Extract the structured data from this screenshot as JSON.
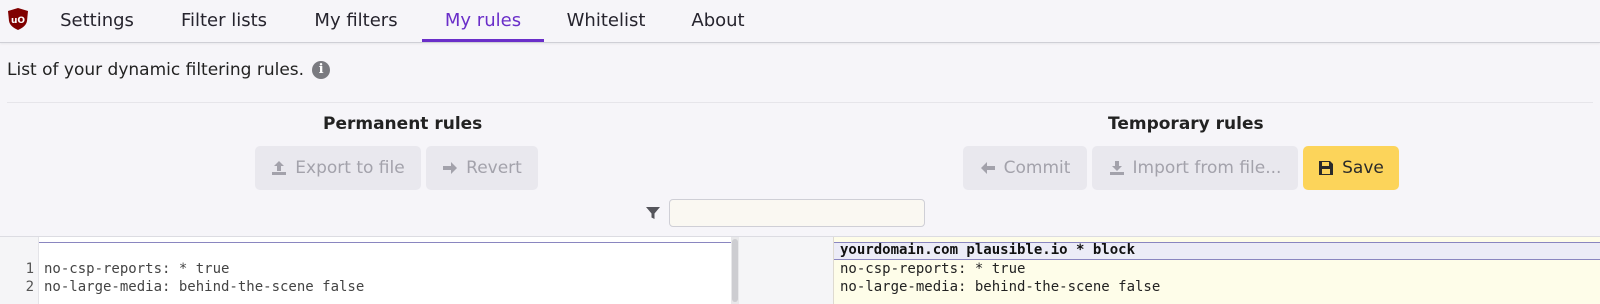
{
  "nav": {
    "tabs": [
      {
        "label": "Settings",
        "active": false
      },
      {
        "label": "Filter lists",
        "active": false
      },
      {
        "label": "My filters",
        "active": false
      },
      {
        "label": "My rules",
        "active": true
      },
      {
        "label": "Whitelist",
        "active": false
      },
      {
        "label": "About",
        "active": false
      }
    ],
    "logo_icon": "ublock-shield-icon"
  },
  "description": {
    "text": "List of your dynamic filtering rules.",
    "icon": "info-icon"
  },
  "permanent": {
    "title": "Permanent rules",
    "export_label": "Export to file",
    "revert_label": "Revert",
    "lines": [
      {
        "num": "1",
        "text": "no-csp-reports: * true"
      },
      {
        "num": "2",
        "text": "no-large-media: behind-the-scene false"
      }
    ]
  },
  "temporary": {
    "title": "Temporary rules",
    "commit_label": "Commit",
    "import_label": "Import from file...",
    "save_label": "Save",
    "lines": [
      {
        "text": "yourdomain.com plausible.io * block",
        "changed": true
      },
      {
        "text": "no-csp-reports: * true",
        "changed": false
      },
      {
        "text": "no-large-media: behind-the-scene false",
        "changed": false
      }
    ]
  },
  "filter": {
    "value": "",
    "icon": "filter-icon"
  },
  "colors": {
    "accent": "#6a2ec9",
    "save_button": "#fcd45a",
    "temporary_bg": "#fefde9"
  }
}
